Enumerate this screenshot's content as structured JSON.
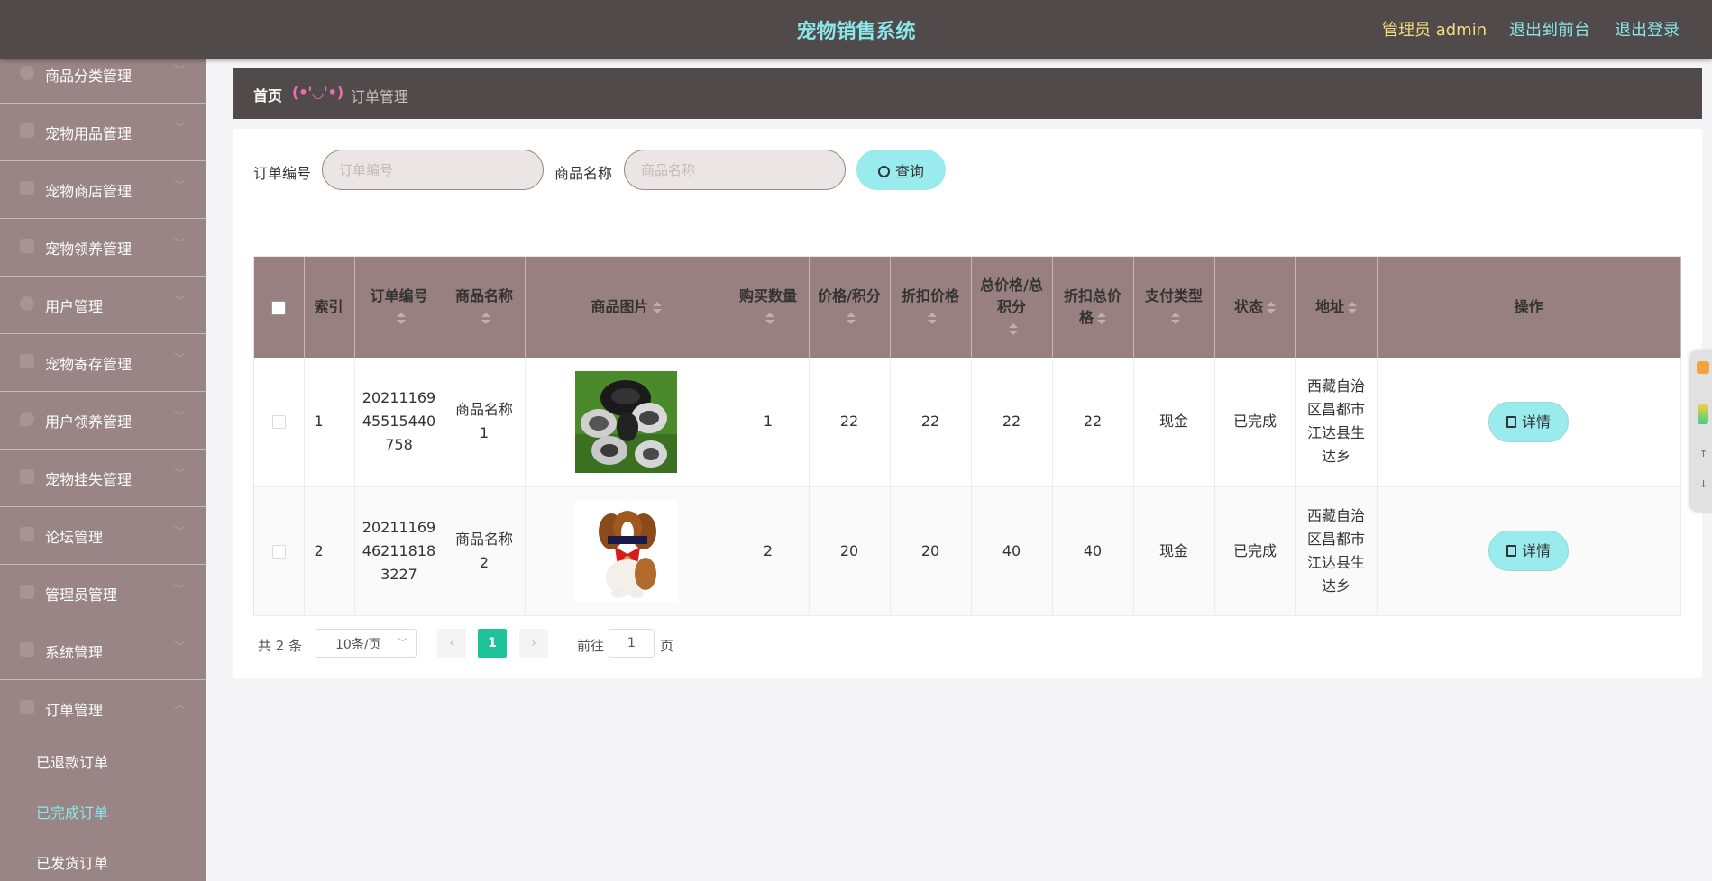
{
  "header": {
    "app_title": "宠物销售系统",
    "admin_label": "管理员 admin",
    "to_front_label": "退出到前台",
    "logout_label": "退出登录"
  },
  "sidebar": {
    "items": [
      {
        "label": "商品分类管理",
        "icon": "clock-icon"
      },
      {
        "label": "宠物用品管理",
        "icon": "goods-icon"
      },
      {
        "label": "宠物商店管理",
        "icon": "clipboard-icon"
      },
      {
        "label": "宠物领养管理",
        "icon": "edit-icon"
      },
      {
        "label": "用户管理",
        "icon": "user-icon"
      },
      {
        "label": "宠物寄存管理",
        "icon": "chart-icon"
      },
      {
        "label": "用户领养管理",
        "icon": "location-icon"
      },
      {
        "label": "宠物挂失管理",
        "icon": "document-icon"
      },
      {
        "label": "论坛管理",
        "icon": "forum-icon"
      },
      {
        "label": "管理员管理",
        "icon": "grid-icon"
      },
      {
        "label": "系统管理",
        "icon": "crop-icon"
      },
      {
        "label": "订单管理",
        "icon": "list-icon"
      }
    ],
    "sub_items": [
      {
        "label": "已退款订单",
        "active": false
      },
      {
        "label": "已完成订单",
        "active": true
      },
      {
        "label": "已发货订单",
        "active": false
      }
    ]
  },
  "breadcrumb": {
    "home": "首页",
    "separator": "(•'◡'•)",
    "current": "订单管理"
  },
  "filters": {
    "order_no_label": "订单编号",
    "order_no_placeholder": "订单编号",
    "goods_name_label": "商品名称",
    "goods_name_placeholder": "商品名称",
    "search_label": "查询"
  },
  "table": {
    "columns": {
      "index": "索引",
      "order_no": "订单编号",
      "goods_name": "商品名称",
      "goods_image": "商品图片",
      "quantity": "购买数量",
      "price": "价格/积分",
      "discount_price": "折扣价格",
      "total": "总价格/总积分",
      "discount_total": "折扣总价格",
      "pay_type": "支付类型",
      "status": "状态",
      "address": "地址",
      "actions": "操作"
    },
    "rows": [
      {
        "index": "1",
        "order_no": "2021116945515440758",
        "goods_name": "商品名称1",
        "image": "pet-bowls-image",
        "quantity": "1",
        "price": "22",
        "discount_price": "22",
        "total": "22",
        "discount_total": "22",
        "pay_type": "现金",
        "status": "已完成",
        "address": "西藏自治区昌都市江达县生达乡",
        "action": "详情"
      },
      {
        "index": "2",
        "order_no": "2021116946211818 3227",
        "goods_name": "商品名称2",
        "image": "puppy-image",
        "quantity": "2",
        "price": "20",
        "discount_price": "20",
        "total": "40",
        "discount_total": "40",
        "pay_type": "现金",
        "status": "已完成",
        "address": "西藏自治区昌都市江达县生达乡",
        "action": "详情"
      }
    ]
  },
  "pagination": {
    "total_text": "共 2 条",
    "page_size": "10条/页",
    "current_page": "1",
    "goto_label": "前往",
    "goto_value": "1",
    "page_suffix": "页"
  },
  "colors": {
    "header_bg": "#514a4a",
    "sidebar_bg": "#998585",
    "accent_cyan": "#8ae8ea",
    "admin_yellow": "#f5dc7a",
    "pager_green": "#1dc49a"
  }
}
